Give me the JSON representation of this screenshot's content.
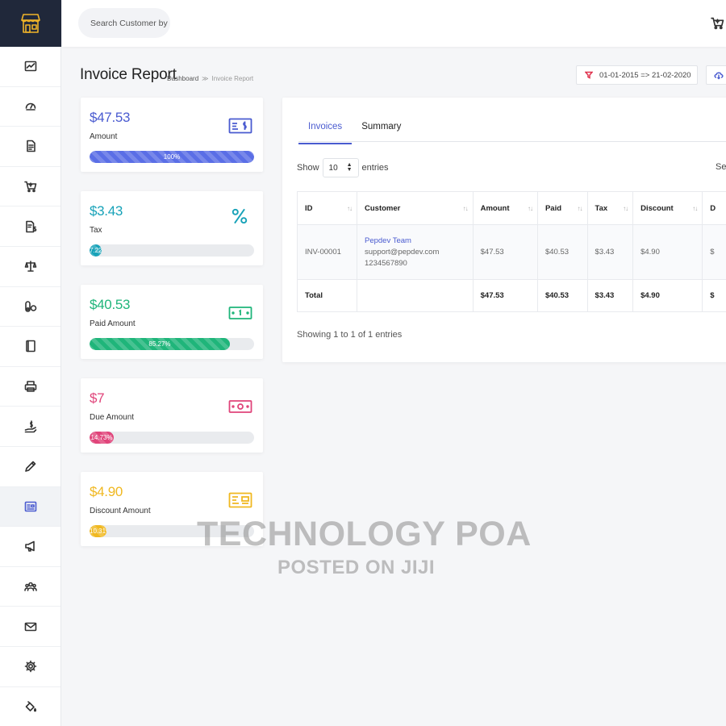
{
  "colors": {
    "accent": "#4a5bd0",
    "tax": "#17a2b8",
    "paid": "#1fb57a",
    "due": "#e0447a",
    "discount": "#f0b820",
    "sidebar_dark": "#20283a"
  },
  "sidebar": {
    "items": [
      {
        "icon": "chart-icon"
      },
      {
        "icon": "dashboard-gauge-icon"
      },
      {
        "icon": "document-icon"
      },
      {
        "icon": "cart-icon"
      },
      {
        "icon": "invoice-dollar-icon"
      },
      {
        "icon": "scale-icon"
      },
      {
        "icon": "toggle-icon"
      },
      {
        "icon": "book-icon"
      },
      {
        "icon": "printer-icon"
      },
      {
        "icon": "hand-dollar-icon"
      },
      {
        "icon": "pen-icon"
      },
      {
        "icon": "report-icon",
        "active": true
      },
      {
        "icon": "megaphone-icon"
      },
      {
        "icon": "users-icon"
      },
      {
        "icon": "mail-icon"
      },
      {
        "icon": "gear-icon"
      },
      {
        "icon": "paint-bucket-icon"
      }
    ]
  },
  "topbar": {
    "search_placeholder": "Search Customer by"
  },
  "header": {
    "title": "Invoice Report",
    "breadcrumb": {
      "home": "Dashboard",
      "separator": "≫",
      "current": "Invoice Report"
    },
    "date_range": "01-01-2015 => 21-02-2020"
  },
  "stats": [
    {
      "value": "$47.53",
      "label": "Amount",
      "progress_text": "100%",
      "progress": 1.0,
      "color": "#5a6ee6"
    },
    {
      "value": "$3.43",
      "label": "Tax",
      "progress_text": "7.22",
      "progress": 0.0722,
      "color": "#17a2b8"
    },
    {
      "value": "$40.53",
      "label": "Paid Amount",
      "progress_text": "85.27%",
      "progress": 0.8527,
      "color": "#1fb57a"
    },
    {
      "value": "$7",
      "label": "Due Amount",
      "progress_text": "14.73%",
      "progress": 0.1473,
      "color": "#e0447a"
    },
    {
      "value": "$4.90",
      "label": "Discount Amount",
      "progress_text": "10.31%",
      "progress": 0.1031,
      "color": "#f0b820"
    }
  ],
  "tabs": [
    "Invoices",
    "Summary"
  ],
  "controls": {
    "show_label": "Show",
    "entries_value": "10",
    "entries_label": "entries",
    "search_label": "Se"
  },
  "table": {
    "columns": [
      "ID",
      "Customer",
      "Amount",
      "Paid",
      "Tax",
      "Discount",
      "D"
    ],
    "rows": [
      {
        "id": "INV-00001",
        "customer_name": "Pepdev Team",
        "customer_email": "support@pepdev.com",
        "customer_phone": "1234567890",
        "amount": "$47.53",
        "paid": "$40.53",
        "tax": "$3.43",
        "discount": "$4.90",
        "due": "$"
      }
    ],
    "total": {
      "label": "Total",
      "amount": "$47.53",
      "paid": "$40.53",
      "tax": "$3.43",
      "discount": "$4.90",
      "due": "$"
    }
  },
  "footer_info": "Showing 1 to 1 of 1 entries",
  "watermark": {
    "line1": "TECHNOLOGY POA",
    "line2": "POSTED ON JIJI"
  }
}
